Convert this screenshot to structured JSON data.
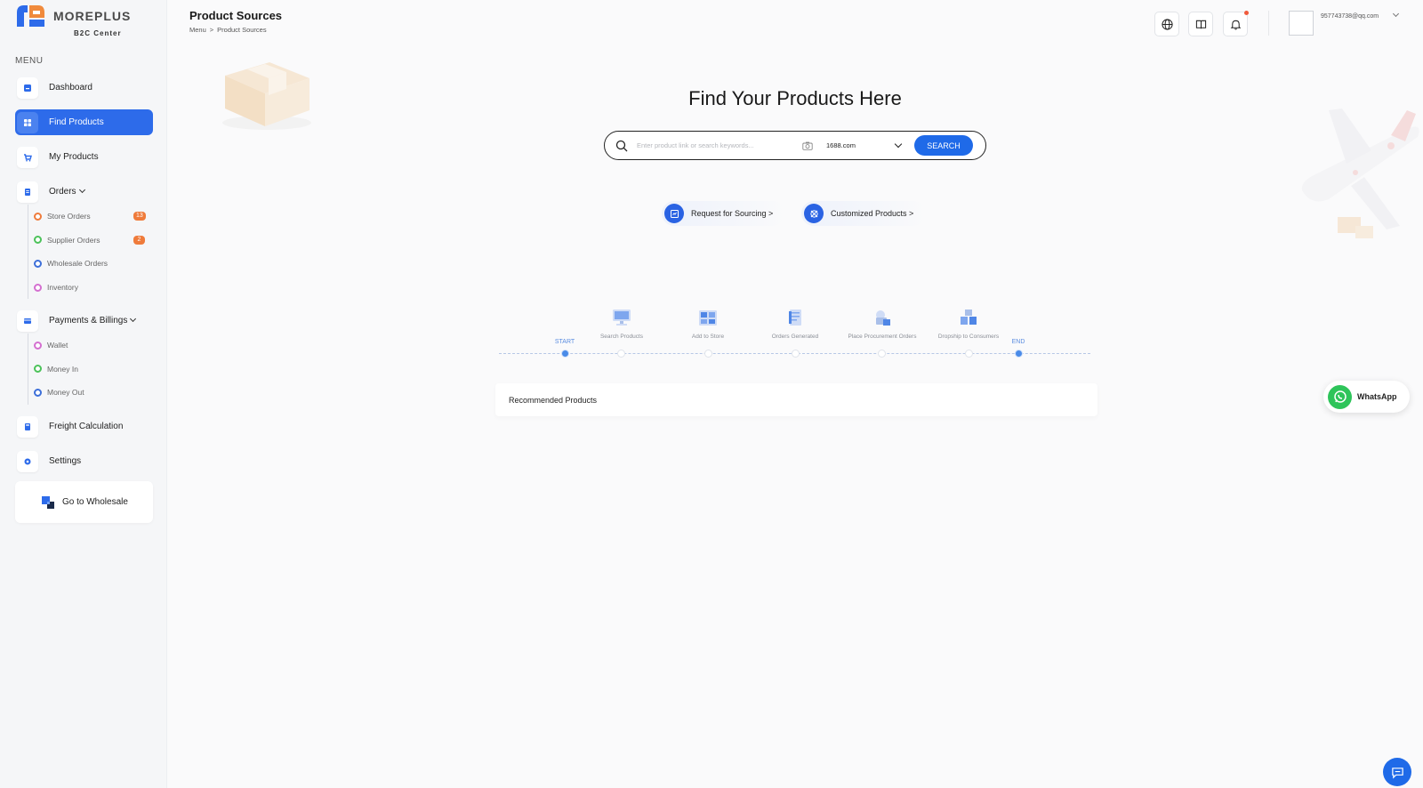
{
  "brand": {
    "name": "MOREPLUS",
    "subtitle": "B2C Center"
  },
  "sidebar": {
    "menu_title": "MENU",
    "items": [
      {
        "label": "Dashboard",
        "icon": "dashboard-icon"
      },
      {
        "label": "Find Products",
        "icon": "grid-icon",
        "active": true
      },
      {
        "label": "My Products",
        "icon": "cart-icon"
      },
      {
        "label": "Orders",
        "icon": "orders-icon",
        "expandable": true
      },
      {
        "label": "Payments & Billings",
        "icon": "card-icon",
        "expandable": true
      },
      {
        "label": "Freight Calculation",
        "icon": "calculator-icon"
      },
      {
        "label": "Settings",
        "icon": "gear-icon"
      }
    ],
    "orders_sub": [
      {
        "label": "Store Orders",
        "badge": "13",
        "color": "#ef7b3b"
      },
      {
        "label": "Supplier Orders",
        "badge": "2",
        "color": "#4cc25a"
      },
      {
        "label": "Wholesale Orders",
        "color": "#3d6fd9"
      },
      {
        "label": "Inventory",
        "color": "#d46fd0"
      }
    ],
    "payments_sub": [
      {
        "label": "Wallet",
        "color": "#d46fd0"
      },
      {
        "label": "Money In",
        "color": "#4cc25a"
      },
      {
        "label": "Money Out",
        "color": "#3d6fd9"
      }
    ],
    "goto_wholesale": "Go to Wholesale"
  },
  "header": {
    "title": "Product Sources",
    "breadcrumb": [
      "Menu",
      ">",
      "Product Sources"
    ],
    "user_email": "957743738@qq.com"
  },
  "main": {
    "hero_title": "Find Your Products Here",
    "search": {
      "placeholder": "Enter product link or search keywords...",
      "site_value": "1688.com",
      "button": "SEARCH"
    },
    "pills": [
      {
        "label": "Request for Sourcing >",
        "icon": "sourcing-icon"
      },
      {
        "label": "Customized Products >",
        "icon": "customize-icon"
      }
    ],
    "timeline": {
      "start": "START",
      "end": "END",
      "steps": [
        {
          "label": "Search Products",
          "icon": "monitor-icon"
        },
        {
          "label": "Add to Store",
          "icon": "store-icon"
        },
        {
          "label": "Orders Generated",
          "icon": "document-icon"
        },
        {
          "label": "Place Procurement Orders",
          "icon": "procurement-icon"
        },
        {
          "label": "Dropship to Consumers",
          "icon": "boxes-icon"
        }
      ]
    },
    "recommended_title": "Recommended Products"
  },
  "whatsapp_label": "WhatsApp",
  "colors": {
    "primary": "#1f6ae8",
    "sidebar_bg": "#f5f6f8",
    "badge": "#ef7b3b"
  }
}
